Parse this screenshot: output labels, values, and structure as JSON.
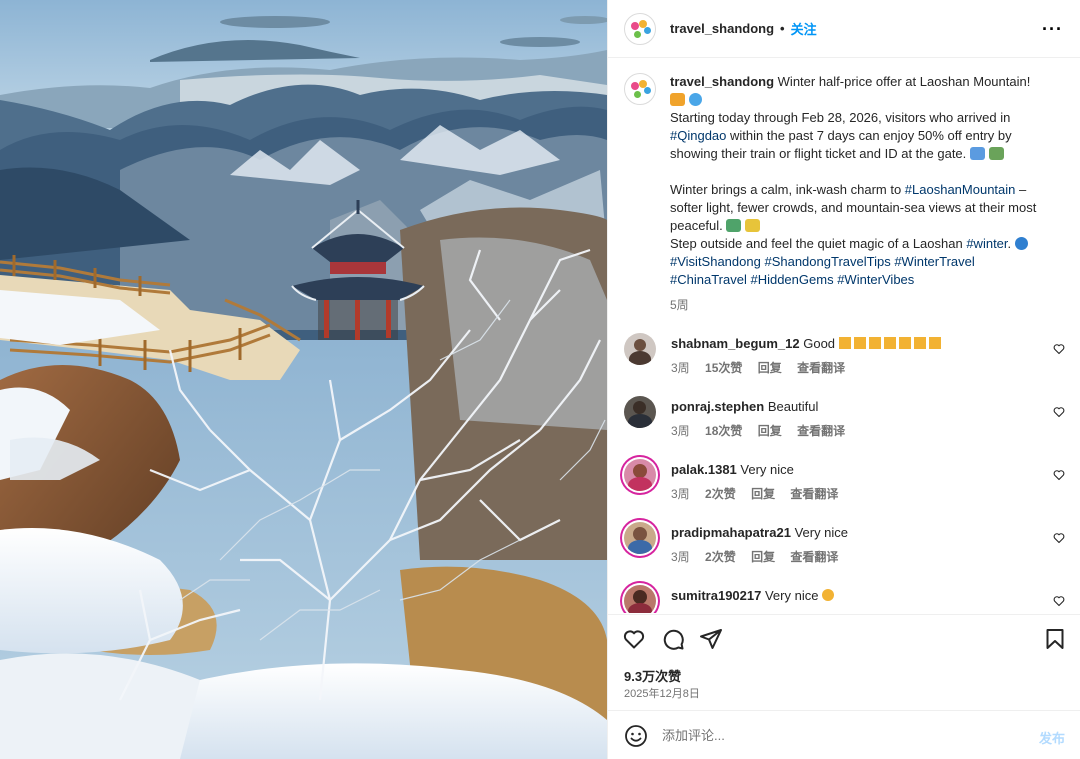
{
  "header": {
    "username": "travel_shandong",
    "separator": "•",
    "follow_label": "关注",
    "more_label": "···"
  },
  "caption": {
    "username": "travel_shandong",
    "line1": "Winter half-price offer at Laoshan Mountain!",
    "p1_a": "Starting today through Feb 28, 2026, visitors who arrived in ",
    "tag_qingdao": "#Qingdao",
    "p1_b": " within the past 7 days can enjoy 50% off entry by showing their train or flight ticket and ID at the gate.",
    "p2_a": "Winter brings a calm, ink-wash charm to ",
    "tag_laoshan": "#LaoshanMountain",
    "p2_b": " – softer light, fewer crowds, and mountain-sea views at their most peaceful.",
    "p3_a": "Step outside and feel the quiet magic of a Laoshan ",
    "tag_winter": "#winter",
    "p3_b": ".",
    "tag_visit": "#VisitShandong",
    "tag_tips": "#ShandongTravelTips",
    "tag_wintertravel": "#WinterTravel",
    "tag_china": "#ChinaTravel",
    "tag_gems": "#HiddenGems",
    "tag_vibes": "#WinterVibes",
    "time": "5周"
  },
  "comments": [
    {
      "username": "shabnam_begum_12",
      "text": "Good",
      "time": "3周",
      "likes": "15次赞",
      "reply": "回复",
      "translate": "查看翻译"
    },
    {
      "username": "ponraj.stephen",
      "text": "Beautiful",
      "time": "3周",
      "likes": "18次赞",
      "reply": "回复",
      "translate": "查看翻译"
    },
    {
      "username": "palak.1381",
      "text": "Very nice",
      "time": "3周",
      "likes": "2次赞",
      "reply": "回复",
      "translate": "查看翻译"
    },
    {
      "username": "pradipmahapatra21",
      "text": "Very nice",
      "time": "3周",
      "likes": "2次赞",
      "reply": "回复",
      "translate": "查看翻译"
    },
    {
      "username": "sumitra190217",
      "text": "Very nice",
      "time": "",
      "likes": "",
      "reply": "",
      "translate": ""
    }
  ],
  "actions": {
    "likes_count": "9.3万次赞",
    "date": "2025年12月8日"
  },
  "compose": {
    "placeholder": "添加评论...",
    "post_label": "发布"
  },
  "icons": [
    "more-icon",
    "heart-icon",
    "comment-icon",
    "share-icon",
    "bookmark-icon",
    "emoji-icon"
  ],
  "colors": {
    "link": "#0095f6",
    "hashtag": "#00376b",
    "post_disabled": "#b3dbff"
  }
}
